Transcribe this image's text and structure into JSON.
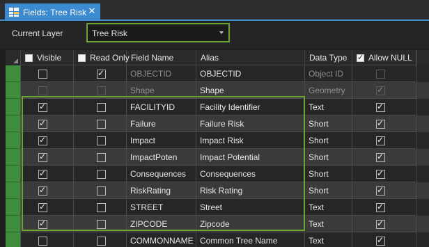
{
  "tab": {
    "title": "Fields:  Tree Risk",
    "icon": "fields-table-icon",
    "close_glyph": "✕"
  },
  "layer": {
    "label": "Current Layer",
    "value": "Tree Risk"
  },
  "columns": [
    {
      "key": "visible",
      "label": "Visible",
      "has_checkbox": true,
      "checked": false
    },
    {
      "key": "readonly",
      "label": "Read Only",
      "has_checkbox": true,
      "checked": false
    },
    {
      "key": "field_name",
      "label": "Field Name",
      "has_checkbox": false
    },
    {
      "key": "alias",
      "label": "Alias",
      "has_checkbox": false
    },
    {
      "key": "data_type",
      "label": "Data Type",
      "has_checkbox": false
    },
    {
      "key": "allow_null",
      "label": "Allow NULL",
      "has_checkbox": true,
      "checked": true
    }
  ],
  "rows": [
    {
      "visible": false,
      "visible_disabled": false,
      "readonly": true,
      "field_name": "OBJECTID",
      "alias": "OBJECTID",
      "data_type": "Object ID",
      "allow_null": false,
      "null_disabled": true,
      "dim": true
    },
    {
      "visible": false,
      "visible_disabled": true,
      "readonly": false,
      "readonly_disabled": true,
      "field_name": "Shape",
      "alias": "Shape",
      "data_type": "Geometry",
      "allow_null": true,
      "null_disabled": true,
      "dim": true
    },
    {
      "visible": true,
      "readonly": false,
      "field_name": "FACILITYID",
      "alias": "Facility Identifier",
      "data_type": "Text",
      "allow_null": true
    },
    {
      "visible": true,
      "readonly": false,
      "field_name": "Failure",
      "alias": "Failure Risk",
      "data_type": "Short",
      "allow_null": true
    },
    {
      "visible": true,
      "readonly": false,
      "field_name": "Impact",
      "alias": "Impact Risk",
      "data_type": "Short",
      "allow_null": true
    },
    {
      "visible": true,
      "readonly": false,
      "field_name": "ImpactPoten",
      "alias": "Impact Potential",
      "data_type": "Short",
      "allow_null": true
    },
    {
      "visible": true,
      "readonly": false,
      "field_name": "Consequences",
      "alias": "Consequences",
      "data_type": "Short",
      "allow_null": true
    },
    {
      "visible": true,
      "readonly": false,
      "field_name": "RiskRating",
      "alias": "Risk Rating",
      "data_type": "Short",
      "allow_null": true
    },
    {
      "visible": true,
      "readonly": false,
      "field_name": "STREET",
      "alias": "Street",
      "data_type": "Text",
      "allow_null": true
    },
    {
      "visible": true,
      "readonly": false,
      "field_name": "ZIPCODE",
      "alias": "Zipcode",
      "data_type": "Text",
      "allow_null": true
    },
    {
      "visible": false,
      "readonly": false,
      "field_name": "COMMONNAME",
      "alias": "Common Tree Name",
      "data_type": "Text",
      "allow_null": true
    }
  ],
  "colors": {
    "accent_tab": "#3c8bd0",
    "highlight": "#6ba531",
    "row_header": "#3d8d3d"
  }
}
